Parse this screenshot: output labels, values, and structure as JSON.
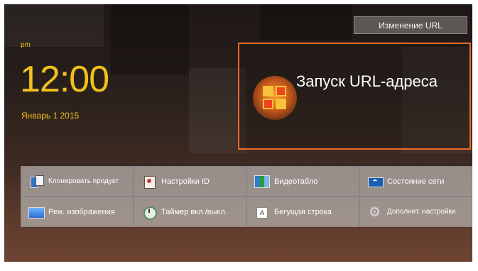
{
  "header": {
    "url_change_label": "Изменение URL"
  },
  "clock": {
    "ampm": "pm",
    "time": "12:00",
    "date": "Январь 1 2015"
  },
  "launch_tile": {
    "title": "Запуск URL-адреса",
    "icon": "url-launcher-icon",
    "border_color": "#e86a2a"
  },
  "menu": {
    "items": [
      {
        "label": "Клонировать продукт",
        "icon": "clone-product-icon"
      },
      {
        "label": "Настройки ID",
        "icon": "id-settings-icon"
      },
      {
        "label": "Видеотабло",
        "icon": "video-wall-icon"
      },
      {
        "label": "Состояние сети",
        "icon": "network-status-icon"
      },
      {
        "label": "Реж. изображения",
        "icon": "picture-mode-icon"
      },
      {
        "label": "Таймер вкл./выкл.",
        "icon": "on-off-timer-icon"
      },
      {
        "label": "Бегущая строка",
        "icon": "ticker-icon"
      },
      {
        "label": "Дополнит. настройки",
        "icon": "more-settings-icon"
      }
    ]
  },
  "colors": {
    "accent_clock": "#f1c01c",
    "focus_border": "#e86a2a"
  }
}
